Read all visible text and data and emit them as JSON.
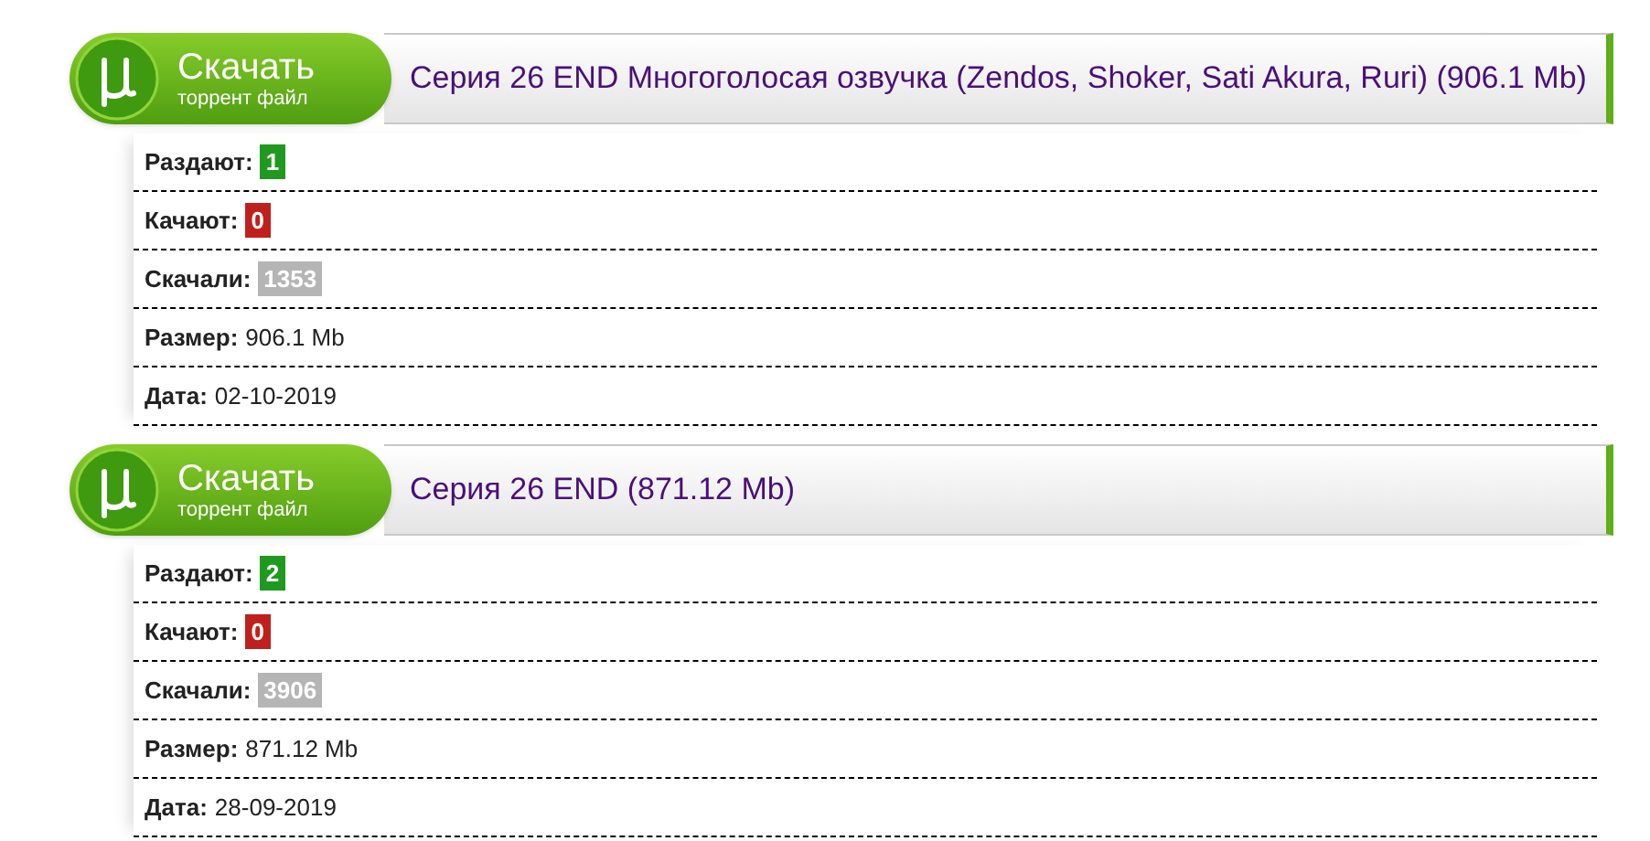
{
  "torrents": [
    {
      "button": {
        "title": "Скачать",
        "subtitle": "торрент файл"
      },
      "name": "Серия 26 END Многоголосая озвучка (Zendos, Shoker, Sati Akura, Ruri) (906.1 Mb)",
      "stats": [
        {
          "kind": "badge",
          "label": "Раздают:",
          "value": "1",
          "color": "#1f9a1f"
        },
        {
          "kind": "badge",
          "label": "Качают:",
          "value": "0",
          "color": "#c0201c"
        },
        {
          "kind": "badge",
          "label": "Скачали:",
          "value": "1353",
          "color": "#b5b5b5"
        },
        {
          "kind": "text",
          "label": "Размер:",
          "value": "906.1 Mb"
        },
        {
          "kind": "text",
          "label": "Дата:",
          "value": "02-10-2019"
        }
      ]
    },
    {
      "button": {
        "title": "Скачать",
        "subtitle": "торрент файл"
      },
      "name": "Серия 26 END (871.12 Mb)",
      "stats": [
        {
          "kind": "badge",
          "label": "Раздают:",
          "value": "2",
          "color": "#1f9a1f"
        },
        {
          "kind": "badge",
          "label": "Качают:",
          "value": "0",
          "color": "#c0201c"
        },
        {
          "kind": "badge",
          "label": "Скачали:",
          "value": "3906",
          "color": "#b5b5b5"
        },
        {
          "kind": "text",
          "label": "Размер:",
          "value": "871.12 Mb"
        },
        {
          "kind": "text",
          "label": "Дата:",
          "value": "28-09-2019"
        }
      ]
    }
  ]
}
